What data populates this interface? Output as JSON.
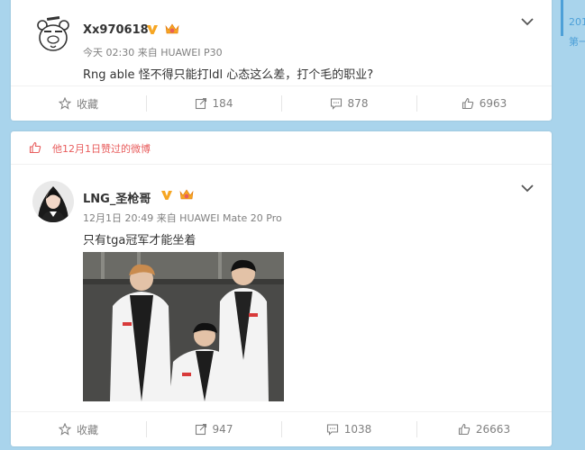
{
  "timeline": {
    "year": "201",
    "page": "第一"
  },
  "post1": {
    "username": "Xx970618",
    "meta": "今天 02:30 来自 HUAWEI P30",
    "text": "Rng able 怪不得只能打ldl 心态这么差，打个毛的职业?",
    "actions": {
      "favorite": "收藏",
      "repost": "184",
      "comment": "878",
      "like": "6963"
    }
  },
  "post2": {
    "liked_notice": "他12月1日赞过的微博",
    "username": "LNG_圣枪哥",
    "meta": "12月1日 20:49 来自 HUAWEI Mate 20 Pro",
    "text": "只有tga冠军才能坐着",
    "actions": {
      "favorite": "收藏",
      "repost": "947",
      "comment": "1038",
      "like": "26663"
    }
  },
  "colors": {
    "background": "#a9d4ec",
    "verified": "#f6a623",
    "liked": "#e85d5d",
    "timeline": "#4da0d8"
  },
  "icons": [
    "bear-avatar",
    "verified-v-icon",
    "crown-badge-icon",
    "chevron-down-icon",
    "star-icon",
    "repost-icon",
    "comment-icon",
    "thumbs-up-icon"
  ]
}
